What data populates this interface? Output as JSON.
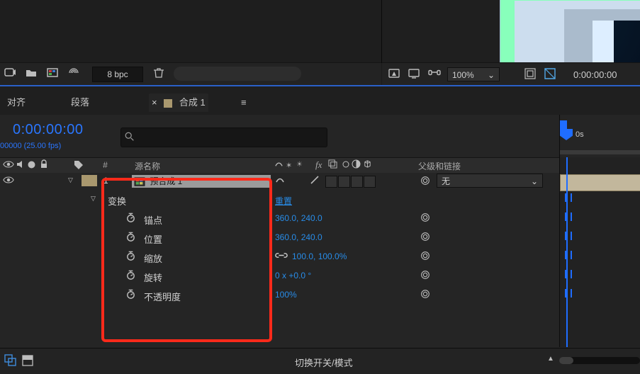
{
  "tabs": {
    "align": "对齐",
    "paragraph": "段落",
    "comp_prefix": "合成 1",
    "close_x": "×"
  },
  "project_toolbar": {
    "bpc": "8 bpc"
  },
  "viewer_toolbar": {
    "zoom_label": "100%",
    "time_display": "0:00:00:00"
  },
  "timecode": {
    "value": "0:00:00:00",
    "sub": "00000 (25.00 fps)"
  },
  "columns": {
    "source_name": "源名称",
    "parent_link": "父级和链接",
    "label_hash": "#"
  },
  "layer": {
    "index": "1",
    "name": "预合成 1",
    "parent_none": "无"
  },
  "transform": {
    "group_label": "变换",
    "reset": "重置",
    "anchor": {
      "label": "锚点",
      "value": "360.0, 240.0"
    },
    "position": {
      "label": "位置",
      "value": "360.0, 240.0"
    },
    "scale": {
      "label": "缩放",
      "value": "100.0, 100.0%",
      "linked": true
    },
    "rotation": {
      "label": "旋转",
      "value": "0 x +0.0 °"
    },
    "opacity": {
      "label": "不透明度",
      "value": "100%"
    }
  },
  "ruler": {
    "tick0": "0s"
  },
  "bottom": {
    "toggle_label": "切换开关/模式"
  },
  "icons": {
    "play": "play-icon",
    "folder_comp": "composition-icon",
    "folder": "folder-icon",
    "color_depth": "color-depth-icon",
    "trash": "trash-icon",
    "grid": "grid-icon",
    "screen": "screen-icon",
    "mask_goggles": "mask-icon",
    "region": "region-icon",
    "transparency": "transparency-icon",
    "tag": "tag-icon",
    "eye": "eye-icon",
    "speaker": "speaker-icon",
    "solo": "solo-icon",
    "lock": "lock-icon",
    "shy": "shy-icon",
    "star_fx": "effect-icon",
    "motionblur": "motion-blur-icon",
    "graph": "graph-editor-icon",
    "render": "render-icon",
    "draft3d": "draft3d-icon",
    "frame_blend": "frame-blend-icon",
    "stopwatch": "stopwatch-icon",
    "spiral": "pickwhip-icon",
    "link": "link-icon",
    "twirl_down": "twirl-down-icon",
    "twirl_right": "twirl-right-icon",
    "search": "search-icon",
    "settings": "settings-icon",
    "menu": "panel-menu-icon"
  }
}
